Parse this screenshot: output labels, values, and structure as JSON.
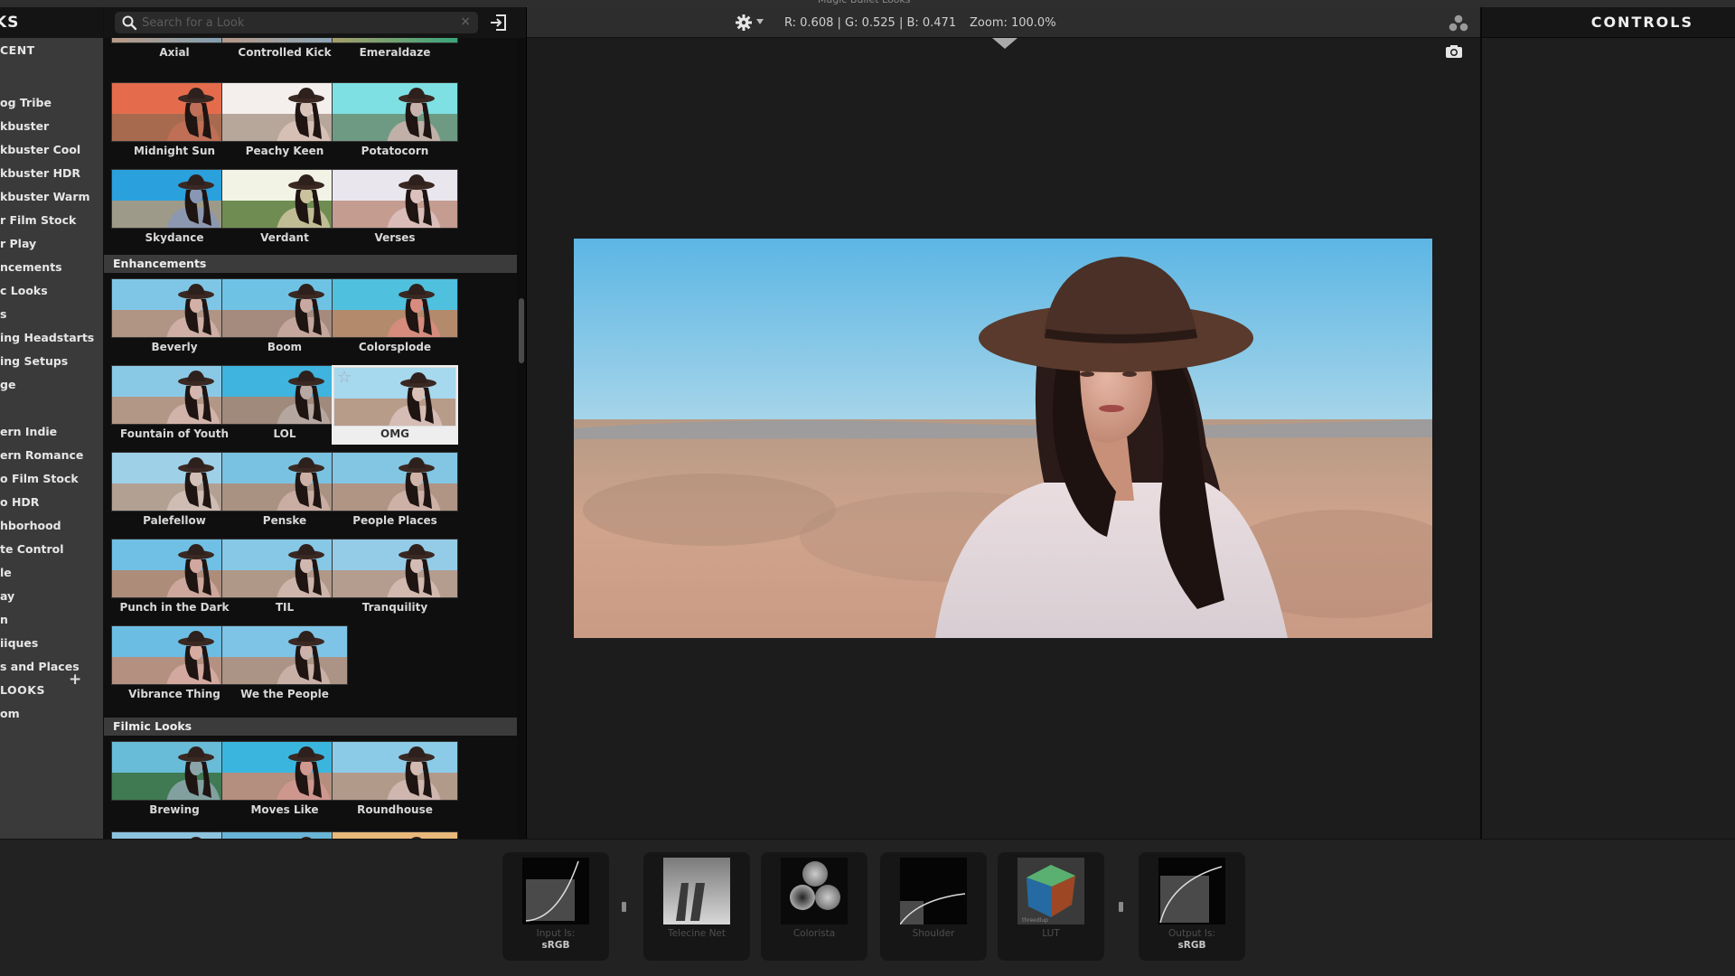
{
  "app": {
    "title": "Magic Bullet Looks"
  },
  "sidebar": {
    "header": "KS",
    "items": [
      {
        "label": "CENT",
        "cap": true
      },
      {
        "label": "og Tribe"
      },
      {
        "label": "kbuster"
      },
      {
        "label": "kbuster Cool"
      },
      {
        "label": "kbuster HDR"
      },
      {
        "label": "kbuster Warm"
      },
      {
        "label": "r Film Stock"
      },
      {
        "label": "r Play"
      },
      {
        "label": "ncements"
      },
      {
        "label": "c Looks"
      },
      {
        "label": "s"
      },
      {
        "label": "ing Headstarts"
      },
      {
        "label": "ing Setups"
      },
      {
        "label": "ge"
      },
      {
        "label": "ern Indie"
      },
      {
        "label": "ern Romance"
      },
      {
        "label": "o Film Stock"
      },
      {
        "label": "o HDR"
      },
      {
        "label": "hborhood"
      },
      {
        "label": "te Control"
      },
      {
        "label": "le"
      },
      {
        "label": "ay"
      },
      {
        "label": "n"
      },
      {
        "label": "iiques"
      },
      {
        "label": "s and Places"
      },
      {
        "label": "LOOKS",
        "cap": true
      },
      {
        "label": "om"
      }
    ],
    "add_icon": "+"
  },
  "looks_panel": {
    "search": {
      "placeholder": "Search for a Look",
      "value": "",
      "clear_icon": "×"
    },
    "export_icon": "export-icon",
    "partial_row": [
      {
        "label": "Axial",
        "tint": [
          "#b99a86",
          "#7aa0b8"
        ]
      },
      {
        "label": "Controlled Kick",
        "tint": [
          "#b59987",
          "#86a7bd"
        ]
      },
      {
        "label": "Emeraldaze",
        "tint": [
          "#a79e6a",
          "#39a57c"
        ]
      }
    ],
    "rows_top": [
      [
        {
          "label": "Midnight Sun",
          "sky": "#e46c4c",
          "ground": "#a86a4e",
          "skin": "#c07058"
        },
        {
          "label": "Peachy Keen",
          "sky": "#f4efec",
          "ground": "#b7a69a",
          "skin": "#d9c2b8"
        },
        {
          "label": "Potatocorn",
          "sky": "#7ee0e2",
          "ground": "#6e9a84",
          "skin": "#c9b2ab"
        }
      ],
      [
        {
          "label": "Skydance",
          "sky": "#2aa1dd",
          "ground": "#9e9a8a",
          "skin": "#8898b4"
        },
        {
          "label": "Verdant",
          "sky": "#f2f3e4",
          "ground": "#6f8d52",
          "skin": "#c9c29c"
        },
        {
          "label": "Verses",
          "sky": "#eae6ee",
          "ground": "#c59c90",
          "skin": "#dcc0bd"
        }
      ]
    ],
    "sections": [
      {
        "title": "Enhancements",
        "looks": [
          {
            "label": "Beverly",
            "sky": "#7fc6e6",
            "ground": "#b09484",
            "skin": "#d2b0a8"
          },
          {
            "label": "Boom",
            "sky": "#6ec3e4",
            "ground": "#a48b7e",
            "skin": "#c8a8a0"
          },
          {
            "label": "Colorsplode",
            "sky": "#4fc0de",
            "ground": "#b48a6c",
            "skin": "#d88c80"
          },
          {
            "label": "Fountain of Youth",
            "sky": "#8ac9e6",
            "ground": "#b39786",
            "skin": "#d4b6ae"
          },
          {
            "label": "LOL",
            "sky": "#3fb4de",
            "ground": "#a08a7c",
            "skin": "#b8a8a4"
          },
          {
            "label": "OMG",
            "sky": "#a6d8ee",
            "ground": "#b89c8a",
            "skin": "#d8c0b8",
            "selected": true,
            "favorite_icon": "☆"
          },
          {
            "label": "Palefellow",
            "sky": "#9ed0e8",
            "ground": "#b2a092",
            "skin": "#d2c0b8"
          },
          {
            "label": "Penske",
            "sky": "#7ac2e2",
            "ground": "#aa9282",
            "skin": "#ccb0a6"
          },
          {
            "label": "People Places",
            "sky": "#82c6e4",
            "ground": "#b09484",
            "skin": "#d0b4aa"
          },
          {
            "label": "Punch in the Dark",
            "sky": "#6fc0e4",
            "ground": "#ad8c7a",
            "skin": "#d0a8a0"
          },
          {
            "label": "TIL",
            "sky": "#86c8e6",
            "ground": "#b09888",
            "skin": "#d0b8b0"
          },
          {
            "label": "Tranquility",
            "sky": "#94cce8",
            "ground": "#b49c8e",
            "skin": "#d4bcb4"
          },
          {
            "label": "Vibrance Thing",
            "sky": "#6cbde4",
            "ground": "#b49080",
            "skin": "#d6aca2"
          },
          {
            "label": "We the People",
            "sky": "#7ec4e6",
            "ground": "#ab9485",
            "skin": "#ccb2aa"
          }
        ]
      },
      {
        "title": "Filmic Looks",
        "looks": [
          {
            "label": "Brewing",
            "sky": "#69bcd8",
            "ground": "#3f7a52",
            "skin": "#8aa4a8"
          },
          {
            "label": "Moves Like",
            "sky": "#3ab6de",
            "ground": "#b48e7e",
            "skin": "#d09890"
          },
          {
            "label": "Roundhouse",
            "sky": "#8ccbe8",
            "ground": "#b29a8a",
            "skin": "#d2bab2"
          }
        ]
      }
    ],
    "partial_bottom_row": [
      {
        "sky": "#8cc4e0",
        "ground": "#a8988c"
      },
      {
        "sky": "#6ab4d8",
        "ground": "#a89488"
      },
      {
        "sky": "#e8b87a",
        "ground": "#c08660"
      }
    ]
  },
  "viewer": {
    "settings_icon": "gear-icon",
    "rgb_readout": "R: 0.608 | G: 0.525 | B: 0.471",
    "zoom_readout": "Zoom: 100.0%",
    "scopes_icon": "scopes-icon",
    "snapshot_icon": "camera-icon"
  },
  "controls": {
    "title": "CONTROLS"
  },
  "pipeline": {
    "tools": [
      {
        "name": "input",
        "label": "Input Is:",
        "sub": "sRGB",
        "kind": "curve-in"
      },
      {
        "name": "telecine-net",
        "label": "Telecine Net",
        "sub": "",
        "kind": "telecine"
      },
      {
        "name": "colorista",
        "label": "Colorista",
        "sub": "",
        "kind": "wheels"
      },
      {
        "name": "shoulder",
        "label": "Shoulder",
        "sub": "",
        "kind": "shoulder"
      },
      {
        "name": "lut",
        "label": "LUT",
        "sub": "",
        "kind": "lut",
        "lut_caption": "threedlup"
      },
      {
        "name": "output",
        "label": "Output Is:",
        "sub": "sRGB",
        "kind": "curve-out"
      }
    ]
  }
}
